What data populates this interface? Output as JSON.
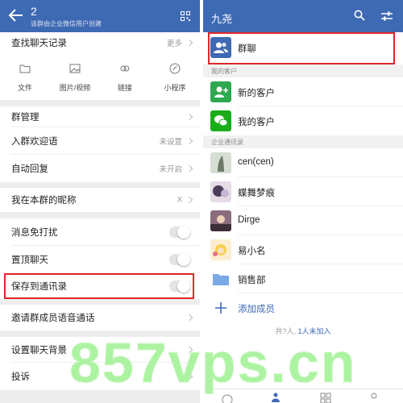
{
  "left": {
    "header": {
      "title": "2",
      "subtitle": "该群由企业微信用户创建"
    },
    "search_history": {
      "label": "查找聊天记录",
      "more": "更多"
    },
    "media": [
      {
        "label": "文件",
        "icon": "folder-icon"
      },
      {
        "label": "图片/视频",
        "icon": "image-icon"
      },
      {
        "label": "链接",
        "icon": "link-icon"
      },
      {
        "label": "小程序",
        "icon": "mini-program-icon"
      }
    ],
    "group_manage": {
      "label": "群管理"
    },
    "welcome": {
      "label": "入群欢迎语",
      "value": "未设置"
    },
    "auto_reply": {
      "label": "自动回复",
      "value": "未开启"
    },
    "nickname": {
      "label": "我在本群的昵称",
      "value": "X"
    },
    "mute": {
      "label": "消息免打扰",
      "on": false
    },
    "pin": {
      "label": "置顶聊天",
      "on": false
    },
    "save_contacts": {
      "label": "保存到通讯录",
      "on": false
    },
    "voice_call": {
      "label": "邀请群成员语音通话"
    },
    "background": {
      "label": "设置聊天背景"
    },
    "report": {
      "label": "投诉"
    }
  },
  "right": {
    "header": {
      "title": "九尧"
    },
    "group_chat": {
      "label": "群聊"
    },
    "section_customers": "我的客户",
    "new_customer": {
      "label": "新的客户"
    },
    "my_customers": {
      "label": "我的客户"
    },
    "section_directory": "企业通讯录",
    "contacts": [
      {
        "name": "cen(cen)"
      },
      {
        "name": "蝶舞梦痕"
      },
      {
        "name": "Dirge"
      },
      {
        "name": "易小名"
      }
    ],
    "department": {
      "label": "销售部"
    },
    "add_member": {
      "label": "添加成员"
    },
    "footer": {
      "count": "共?人,",
      "inactive": "1人未加入"
    }
  },
  "watermark": "857vps.cn",
  "colors": {
    "header": "#3e69b3",
    "highlight": "#e0262b",
    "green": "#2fa84f",
    "wechat": "#1aad19"
  }
}
